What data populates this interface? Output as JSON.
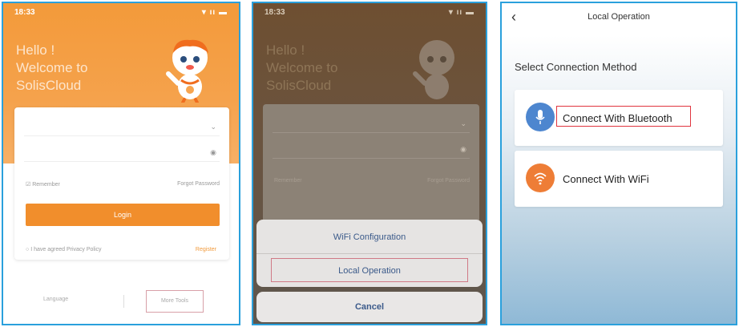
{
  "panel1": {
    "status": {
      "time": "18:33",
      "icons": "▾ ıı ▬"
    },
    "hello": {
      "line1": "Hello !",
      "line2": "Welcome to",
      "line3": "SolisCloud"
    },
    "form": {
      "remember_label": "Remember",
      "forgot_label": "Forgot Password",
      "login_label": "Login",
      "privacy_label": "I have agreed Privacy Policy",
      "register_label": "Register"
    },
    "bottom": {
      "language_label": "Language",
      "more_tools_label": "More Tools"
    }
  },
  "panel2": {
    "status": {
      "time": "18:33",
      "icons": "▾ ıı ▬"
    },
    "hello": {
      "line1": "Hello !",
      "line2": "Welcome to",
      "line3": "SolisCloud"
    },
    "form": {
      "remember_label": "Remember",
      "forgot_label": "Forgot Password"
    },
    "sheet": {
      "wifi_config_label": "WiFi Configuration",
      "local_operation_label": "Local Operation"
    },
    "cancel_label": "Cancel"
  },
  "panel3": {
    "title": "Local Operation",
    "section_title": "Select Connection Method",
    "options": [
      {
        "label": "Connect With Bluetooth",
        "icon": "bluetooth-icon",
        "color": "#4d86cf"
      },
      {
        "label": "Connect With WiFi",
        "icon": "wifi-icon",
        "color": "#ee7d36"
      }
    ]
  },
  "colors": {
    "brand_orange": "#f18e2c",
    "highlight_red": "#e0353f",
    "frame_blue": "#2aa0dc"
  }
}
